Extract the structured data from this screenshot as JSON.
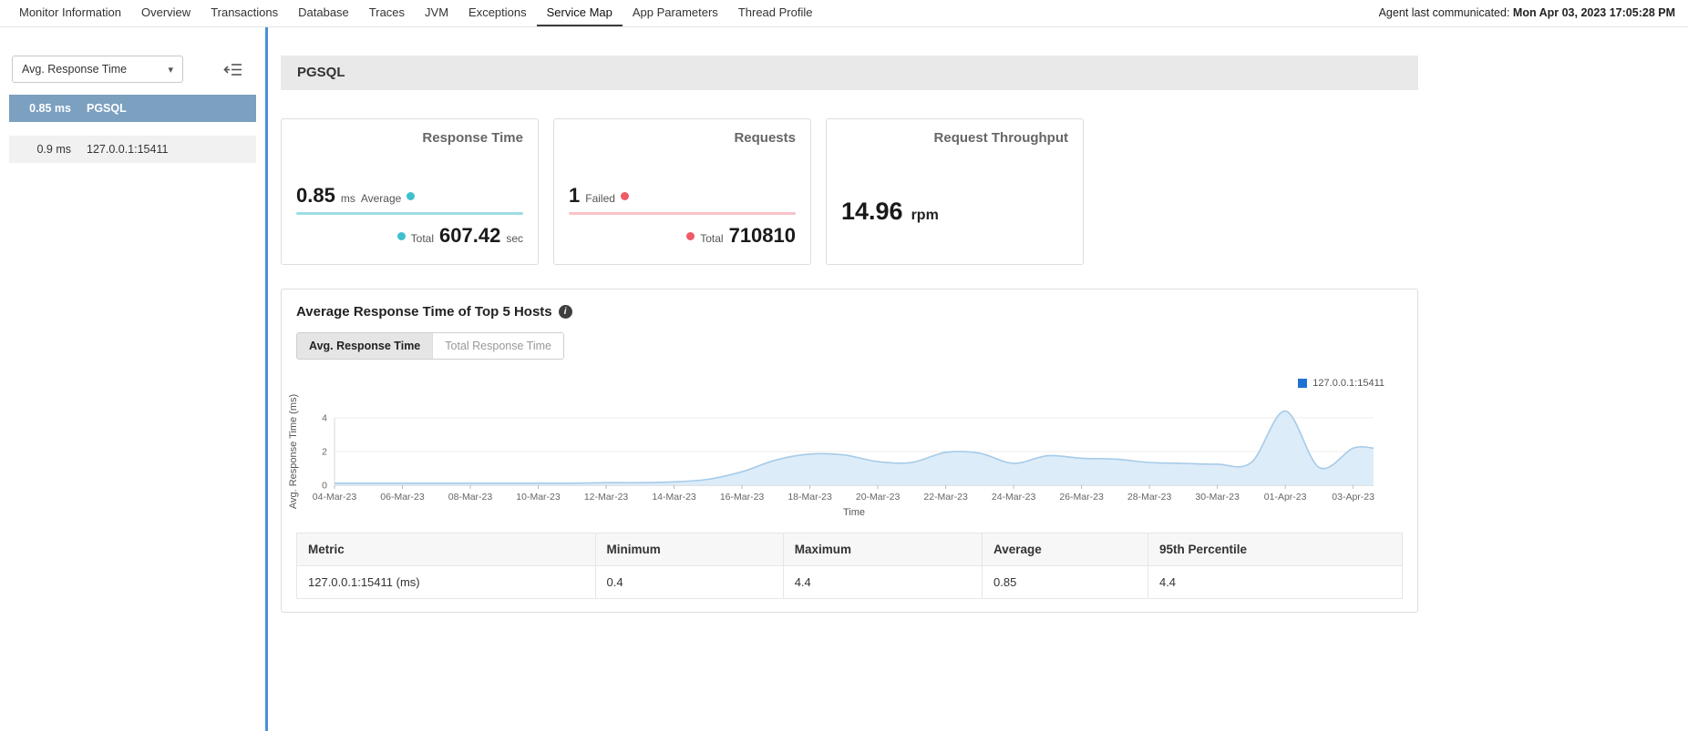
{
  "icons": {
    "info": "i",
    "caret": "▾"
  },
  "nav": {
    "tabs": [
      {
        "label": "Monitor Information"
      },
      {
        "label": "Overview"
      },
      {
        "label": "Transactions"
      },
      {
        "label": "Database"
      },
      {
        "label": "Traces"
      },
      {
        "label": "JVM"
      },
      {
        "label": "Exceptions"
      },
      {
        "label": "Service Map",
        "active": true
      },
      {
        "label": "App Parameters"
      },
      {
        "label": "Thread Profile"
      }
    ],
    "agent_status_label": "Agent last communicated:",
    "agent_status_time": "Mon Apr 03, 2023 17:05:28 PM"
  },
  "sidebar": {
    "metric_dropdown": {
      "value": "Avg. Response Time"
    },
    "items": [
      {
        "value": "0.85 ms",
        "label": "PGSQL",
        "selected": true
      },
      {
        "value": "0.9 ms",
        "label": "127.0.0.1:15411",
        "selected": false
      }
    ]
  },
  "main": {
    "section_header": "PGSQL",
    "cards": {
      "response_time": {
        "title": "Response Time",
        "value": "0.85",
        "unit": "ms",
        "value_label": "Average",
        "total_label": "Total",
        "total_value": "607.42",
        "total_unit": "sec",
        "accent": "#3fc0cd",
        "line_color": "#9bdde4"
      },
      "requests": {
        "title": "Requests",
        "value": "1",
        "value_label": "Failed",
        "total_label": "Total",
        "total_value": "710810",
        "accent": "#ee5a65",
        "line_color": "#f7c3c8"
      },
      "request_throughput": {
        "title": "Request Throughput",
        "value": "14.96",
        "unit": "rpm"
      }
    },
    "chart_section": {
      "title": "Average Response Time of Top 5 Hosts",
      "toggles": [
        {
          "label": "Avg. Response Time",
          "active": true
        },
        {
          "label": "Total Response Time",
          "active": false
        }
      ]
    },
    "table": {
      "headers": [
        "Metric",
        "Minimum",
        "Maximum",
        "Average",
        "95th Percentile"
      ],
      "rows": [
        [
          "127.0.0.1:15411 (ms)",
          "0.4",
          "4.4",
          "0.85",
          "4.4"
        ]
      ]
    }
  },
  "chart_data": {
    "type": "area",
    "title": "Average Response Time of Top 5 Hosts",
    "xlabel": "Time",
    "ylabel": "Avg. Response Time (ms)",
    "ylim": [
      0,
      5
    ],
    "yticks": [
      0,
      2,
      4
    ],
    "grid": "horizontal",
    "legend_position": "top-right",
    "legend": [
      {
        "label": "127.0.0.1:15411",
        "color": "#2072d2"
      }
    ],
    "x_tick_labels": [
      "04-Mar-23",
      "06-Mar-23",
      "08-Mar-23",
      "10-Mar-23",
      "12-Mar-23",
      "14-Mar-23",
      "16-Mar-23",
      "18-Mar-23",
      "20-Mar-23",
      "22-Mar-23",
      "24-Mar-23",
      "26-Mar-23",
      "28-Mar-23",
      "30-Mar-23",
      "01-Apr-23",
      "03-Apr-23"
    ],
    "series": [
      {
        "name": "127.0.0.1:15411",
        "line_color": "#a6cbe8",
        "fill": "#d9eaf8",
        "x": [
          0,
          1,
          2,
          3,
          4,
          5,
          6,
          7,
          8,
          9,
          10,
          11,
          12,
          13,
          14,
          15,
          16,
          17,
          18,
          19,
          20,
          21,
          22,
          23,
          24,
          25,
          26,
          27,
          28,
          29,
          30,
          30.6
        ],
        "values": [
          0.12,
          0.12,
          0.12,
          0.12,
          0.12,
          0.12,
          0.12,
          0.12,
          0.15,
          0.15,
          0.2,
          0.35,
          0.8,
          1.5,
          1.85,
          1.8,
          1.4,
          1.35,
          1.95,
          1.9,
          1.3,
          1.75,
          1.6,
          1.55,
          1.35,
          1.3,
          1.25,
          1.35,
          4.4,
          1.05,
          2.2,
          2.2
        ]
      }
    ]
  }
}
